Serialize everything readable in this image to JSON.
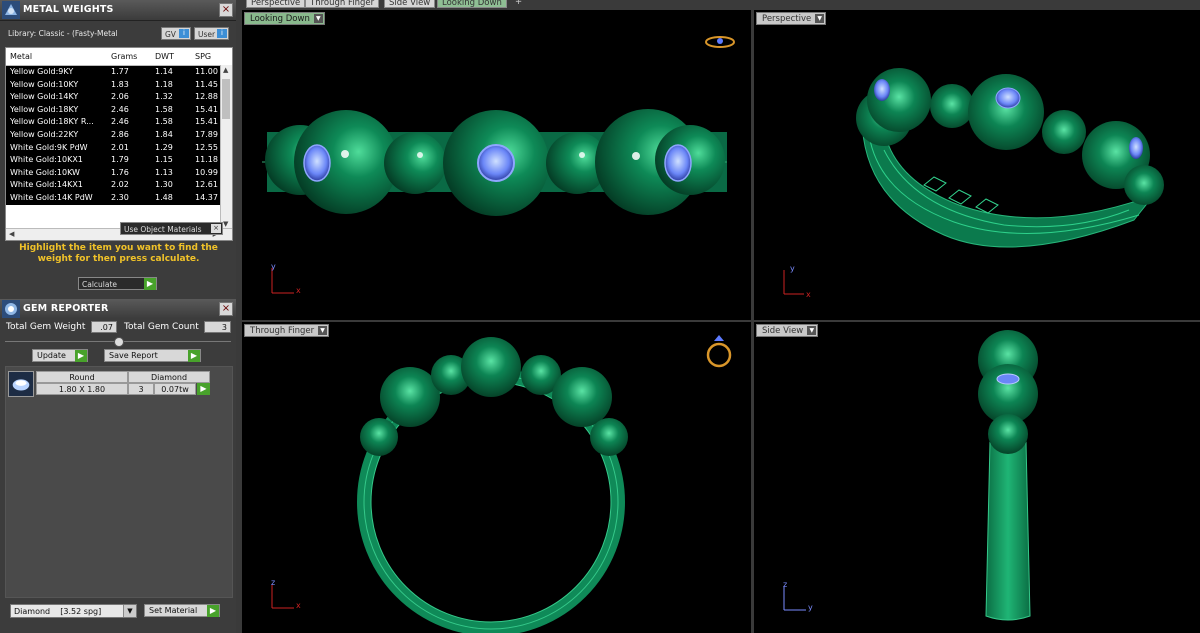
{
  "metal_weights": {
    "title": "METAL WEIGHTS",
    "library": "Library: Classic - (Fasty-Metal",
    "gv_label": "GV",
    "user_label": "User",
    "columns": [
      "Metal",
      "Grams",
      "DWT",
      "SPG"
    ],
    "rows": [
      [
        "Yellow Gold:9KY",
        "1.77",
        "1.14",
        "11.00"
      ],
      [
        "Yellow Gold:10KY",
        "1.83",
        "1.18",
        "11.45"
      ],
      [
        "Yellow Gold:14KY",
        "2.06",
        "1.32",
        "12.88"
      ],
      [
        "Yellow Gold:18KY",
        "2.46",
        "1.58",
        "15.41"
      ],
      [
        "Yellow Gold:18KY R...",
        "2.46",
        "1.58",
        "15.41"
      ],
      [
        "Yellow Gold:22KY",
        "2.86",
        "1.84",
        "17.89"
      ],
      [
        "White Gold:9K PdW",
        "2.01",
        "1.29",
        "12.55"
      ],
      [
        "White Gold:10KX1",
        "1.79",
        "1.15",
        "11.18"
      ],
      [
        "White Gold:10KW",
        "1.76",
        "1.13",
        "10.99"
      ],
      [
        "White Gold:14KX1",
        "2.02",
        "1.30",
        "12.61"
      ],
      [
        "White Gold:14K PdW",
        "2.30",
        "1.48",
        "14.37"
      ]
    ],
    "use_object_materials": "Use Object Materials",
    "hint": "Highlight the item you want to find the weight for then press calculate.",
    "calculate": "Calculate"
  },
  "gem_reporter": {
    "title": "GEM REPORTER",
    "total_weight_label": "Total Gem Weight",
    "total_weight": ".07",
    "total_count_label": "Total Gem Count",
    "total_count": "3",
    "update": "Update",
    "save_report": "Save Report",
    "gem": {
      "shape": "Round",
      "size": "1.80 X 1.80",
      "type": "Diamond",
      "count": "3",
      "weight": "0.07tw"
    },
    "material_select": "Diamond    [3.52 spg]",
    "set_material": "Set Material"
  },
  "top_tabs": [
    "Perspective",
    "Through Finger",
    "Side View",
    "Looking Down"
  ],
  "top_tabs_add": "+",
  "viewports": {
    "top_left": "Looking Down",
    "top_right": "Perspective",
    "bottom_left": "Through Finger",
    "bottom_right": "Side View"
  },
  "axes": {
    "y": "y",
    "x": "x",
    "z": "z"
  },
  "colors": {
    "metal": "#0a6a45",
    "gem": "#6b8cff",
    "active_tab": "#89b98d",
    "hint": "#f0c229"
  }
}
